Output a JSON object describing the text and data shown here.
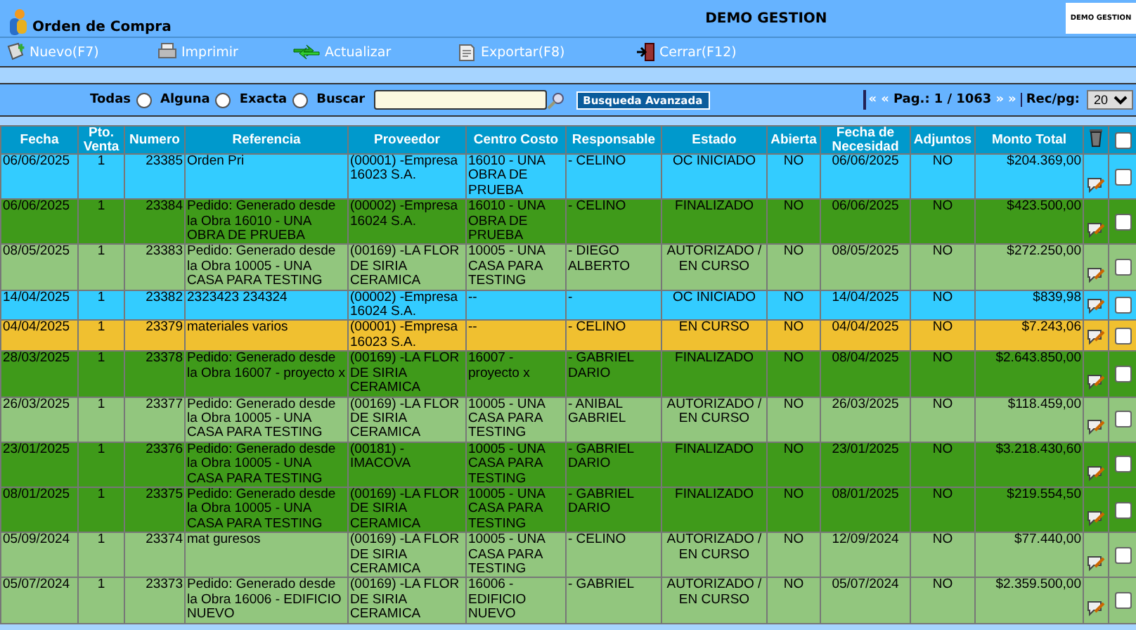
{
  "window": {
    "title": "Orden de Compra",
    "company": "DEMO GESTION",
    "logo_text": "DEMO GESTION"
  },
  "toolbar": [
    {
      "label": "Nuevo(F7)",
      "kind": "new"
    },
    {
      "label": "Imprimir",
      "kind": "print"
    },
    {
      "label": "Actualizar",
      "kind": "refresh"
    },
    {
      "label": "Exportar(F8)",
      "kind": "export"
    },
    {
      "label": "Cerrar(F12)",
      "kind": "close"
    }
  ],
  "search": {
    "options": [
      {
        "label": "Todas",
        "selected": false
      },
      {
        "label": "Alguna",
        "selected": false
      },
      {
        "label": "Exacta",
        "selected": false
      }
    ],
    "field_label": "Buscar",
    "advanced_button": "Busqueda Avanzada"
  },
  "pager": {
    "first": "«",
    "prev": "«",
    "label": "Pag.:",
    "position": "1 / 1063",
    "next": "»",
    "last": "»",
    "per_page_label": "Rec/pg:",
    "per_page": "20"
  },
  "table": {
    "columns": [
      "Fecha",
      "Pto. Venta",
      "Numero",
      "Referencia",
      "Proveedor",
      "Centro Costo",
      "Responsable",
      "Estado",
      "Abierta",
      "Fecha de Necesidad",
      "Adjuntos",
      "Monto Total"
    ],
    "select_all": {
      "checked": false
    },
    "rows": [
      {
        "color": "#33ccff",
        "checked": false,
        "cells": [
          "06/06/2025",
          "1",
          "23385",
          "Orden Pri",
          "(00001) -Empresa 16023 S.A.",
          "16010 - UNA OBRA DE PRUEBA",
          "- CELINO",
          "OC INICIADO",
          "NO",
          "06/06/2025",
          "NO",
          "$204.369,00"
        ]
      },
      {
        "color": "#3f9a1a",
        "checked": false,
        "cells": [
          "06/06/2025",
          "1",
          "23384",
          "Pedido: Generado desde la Obra 16010 - UNA OBRA DE PRUEBA",
          "(00002) -Empresa 16024 S.A.",
          "16010 - UNA OBRA DE PRUEBA",
          "- CELINO",
          "FINALIZADO",
          "NO",
          "06/06/2025",
          "NO",
          "$423.500,00"
        ]
      },
      {
        "color": "#92c67e",
        "checked": false,
        "cells": [
          "08/05/2025",
          "1",
          "23383",
          "Pedido: Generado desde la Obra 10005 - UNA CASA PARA TESTING",
          "(00169) -LA FLOR DE SIRIA CERAMICA",
          "10005 - UNA CASA PARA TESTING",
          "- DIEGO ALBERTO",
          "AUTORIZADO / EN CURSO",
          "NO",
          "08/05/2025",
          "NO",
          "$272.250,00"
        ]
      },
      {
        "color": "#33ccff",
        "checked": false,
        "cells": [
          "14/04/2025",
          "1",
          "23382",
          "2323423 234324",
          "(00002) -Empresa 16024 S.A.",
          "--",
          "-",
          "OC INICIADO",
          "NO",
          "14/04/2025",
          "NO",
          "$839,98"
        ]
      },
      {
        "color": "#f0c030",
        "checked": false,
        "cells": [
          "04/04/2025",
          "1",
          "23379",
          "materiales varios",
          "(00001) -Empresa 16023 S.A.",
          "--",
          "- CELINO",
          "EN CURSO",
          "NO",
          "04/04/2025",
          "NO",
          "$7.243,06"
        ]
      },
      {
        "color": "#3f9a1a",
        "checked": false,
        "cells": [
          "28/03/2025",
          "1",
          "23378",
          "Pedido: Generado desde la Obra 16007 - proyecto x",
          "(00169) -LA FLOR DE SIRIA CERAMICA",
          "16007 - proyecto x",
          "- GABRIEL DARIO",
          "FINALIZADO",
          "NO",
          "08/04/2025",
          "NO",
          "$2.643.850,00"
        ]
      },
      {
        "color": "#92c67e",
        "checked": false,
        "cells": [
          "26/03/2025",
          "1",
          "23377",
          "Pedido: Generado desde la Obra 10005 - UNA CASA PARA TESTING",
          "(00169) -LA FLOR DE SIRIA CERAMICA",
          "10005 - UNA CASA PARA TESTING",
          "- ANIBAL GABRIEL",
          "AUTORIZADO / EN CURSO",
          "NO",
          "26/03/2025",
          "NO",
          "$118.459,00"
        ]
      },
      {
        "color": "#3f9a1a",
        "checked": false,
        "cells": [
          "23/01/2025",
          "1",
          "23376",
          "Pedido: Generado desde la Obra 10005 - UNA CASA PARA TESTING",
          "(00181) -IMACOVA",
          "10005 - UNA CASA PARA TESTING",
          "- GABRIEL DARIO",
          "FINALIZADO",
          "NO",
          "23/01/2025",
          "NO",
          "$3.218.430,60"
        ]
      },
      {
        "color": "#3f9a1a",
        "checked": false,
        "cells": [
          "08/01/2025",
          "1",
          "23375",
          "Pedido: Generado desde la Obra 10005 - UNA CASA PARA TESTING",
          "(00169) -LA FLOR DE SIRIA CERAMICA",
          "10005 - UNA CASA PARA TESTING",
          "- GABRIEL DARIO",
          "FINALIZADO",
          "NO",
          "08/01/2025",
          "NO",
          "$219.554,50"
        ]
      },
      {
        "color": "#92c67e",
        "checked": false,
        "cells": [
          "05/09/2024",
          "1",
          "23374",
          "mat guresos",
          "(00169) -LA FLOR DE SIRIA CERAMICA",
          "10005 - UNA CASA PARA TESTING",
          "- CELINO",
          "AUTORIZADO / EN CURSO",
          "NO",
          "12/09/2024",
          "NO",
          "$77.440,00"
        ]
      },
      {
        "color": "#92c67e",
        "checked": false,
        "cells": [
          "05/07/2024",
          "1",
          "23373",
          "Pedido: Generado desde la Obra 16006 - EDIFICIO NUEVO",
          "(00169) -LA FLOR DE SIRIA CERAMICA",
          "16006 - EDIFICIO NUEVO",
          "- GABRIEL",
          "AUTORIZADO / EN CURSO",
          "NO",
          "05/07/2024",
          "NO",
          "$2.359.500,00"
        ]
      }
    ]
  }
}
